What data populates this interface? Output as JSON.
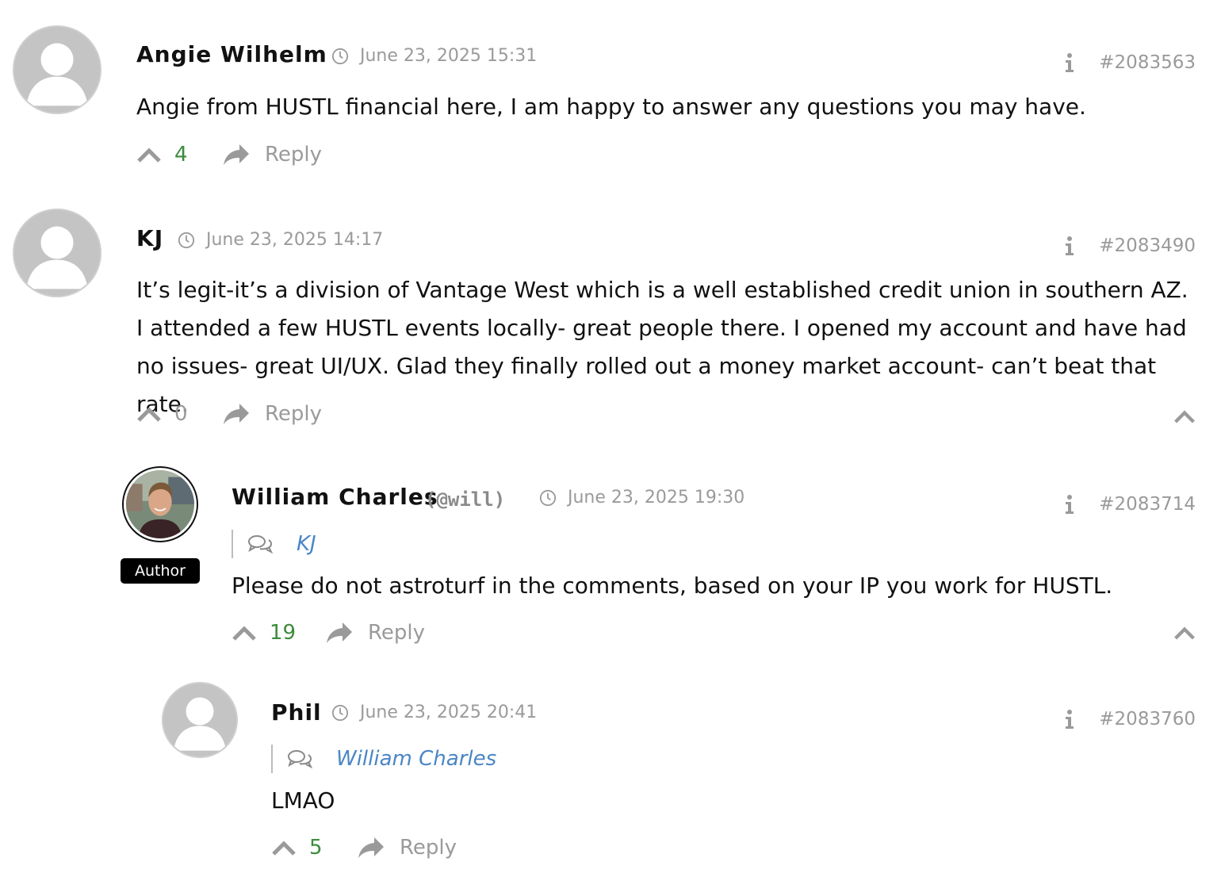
{
  "comments": [
    {
      "author": "Angie Wilhelm",
      "time": "June 23, 2025 15:31",
      "id": "#2083563",
      "text": "Angie from HUSTL financial here, I am happy to answer any questions you may have.",
      "votes": "4",
      "reply_label": "Reply"
    },
    {
      "author": "KJ",
      "time": "June 23, 2025 14:17",
      "id": "#2083490",
      "text": "It’s legit-it’s a division of Vantage West which is a well established credit union in southern AZ. I attended a few HUSTL events locally- great people there. I opened my account and have had no issues- great UI/UX. Glad they finally rolled out a money market account- can’t beat that rate.",
      "votes": "0",
      "reply_label": "Reply"
    },
    {
      "author": "William Charles",
      "handle": "(@will)",
      "badge": "Author",
      "time": "June 23, 2025 19:30",
      "id": "#2083714",
      "in_reply_to": "KJ",
      "text": "Please do not astroturf in the comments, based on your IP you work for HUSTL.",
      "votes": "19",
      "reply_label": "Reply"
    },
    {
      "author": "Phil",
      "time": "June 23, 2025 20:41",
      "id": "#2083760",
      "in_reply_to": "William Charles",
      "text": "LMAO",
      "votes": "5",
      "reply_label": "Reply"
    }
  ],
  "colors": {
    "positive_votes": "#3d8b3d",
    "link": "#4a86c5",
    "muted": "#9a9a9a"
  }
}
